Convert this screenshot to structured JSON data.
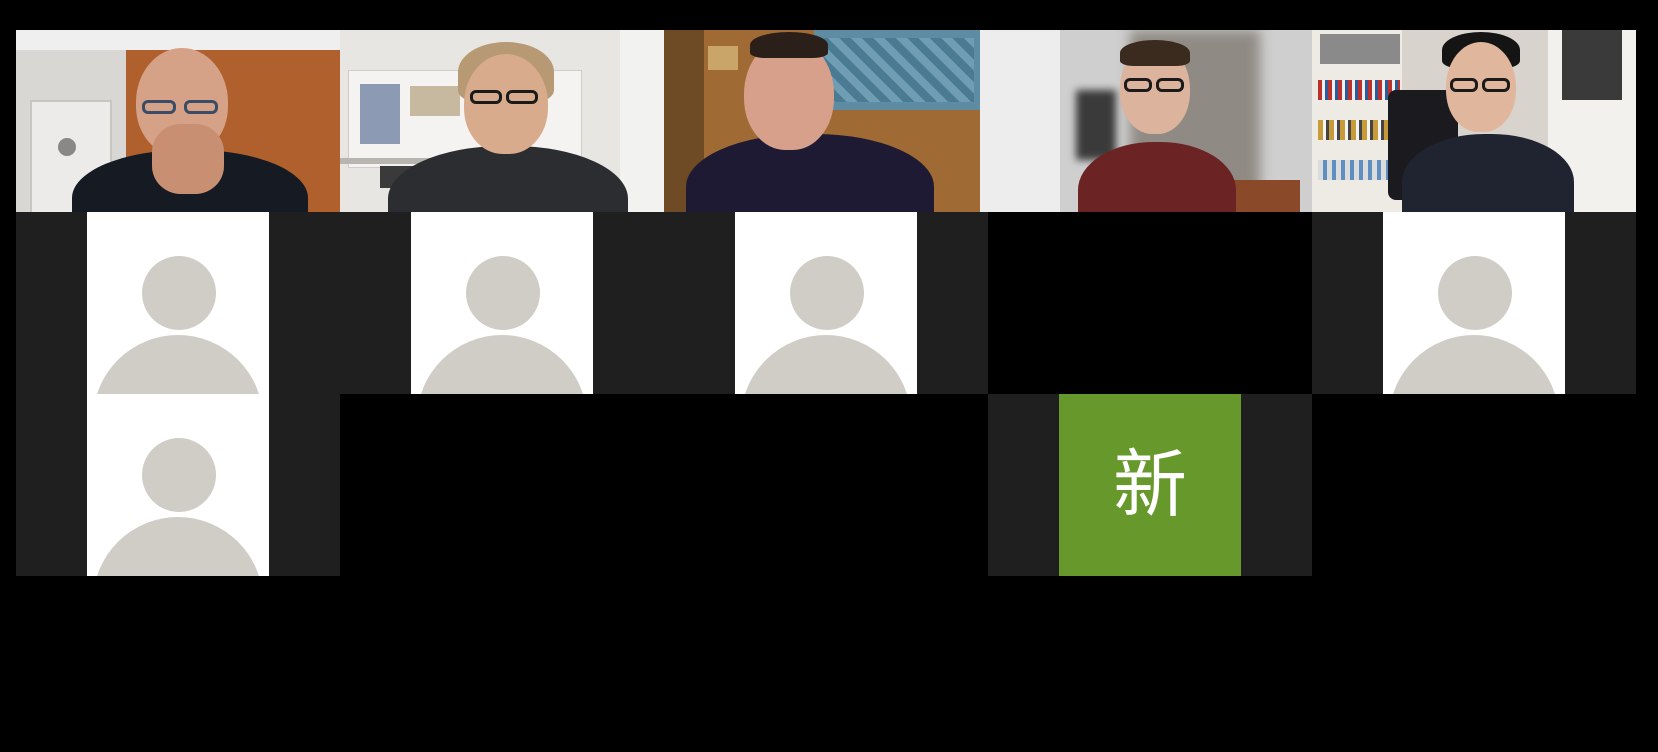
{
  "meeting": {
    "grid": {
      "row1": [
        {
          "type": "video",
          "name": "participant-video-1"
        },
        {
          "type": "video",
          "name": "participant-video-2"
        },
        {
          "type": "video",
          "name": "participant-video-3"
        },
        {
          "type": "video",
          "name": "participant-video-4"
        },
        {
          "type": "video",
          "name": "participant-video-5"
        }
      ],
      "row2": [
        {
          "type": "avatar"
        },
        {
          "type": "avatar"
        },
        {
          "type": "avatar"
        },
        {
          "type": "camera-off"
        },
        {
          "type": "avatar"
        }
      ],
      "row3": [
        {
          "type": "avatar"
        },
        {
          "type": "initial",
          "initial": "新"
        }
      ]
    },
    "colors": {
      "background": "#000000",
      "tile_empty": "#1f1f1f",
      "avatar_bg": "#ffffff",
      "avatar_silhouette": "#cfcdc6",
      "initial_bg": "#67982b",
      "initial_text": "#ffffff"
    },
    "icons": {
      "avatar": "default-user-avatar-icon"
    }
  }
}
